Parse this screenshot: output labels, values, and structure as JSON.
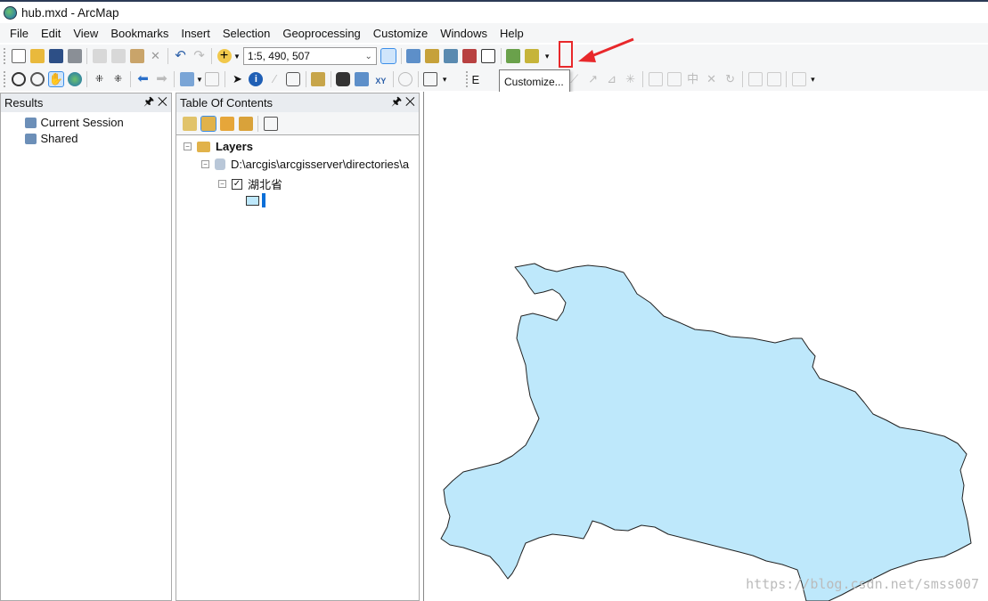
{
  "window": {
    "title": "hub.mxd - ArcMap"
  },
  "menu": [
    "File",
    "Edit",
    "View",
    "Bookmarks",
    "Insert",
    "Selection",
    "Geoprocessing",
    "Customize",
    "Windows",
    "Help"
  ],
  "toolbar": {
    "scale_value": "1:5, 490, 507",
    "tooltip": "Customize...",
    "editor_label": "E"
  },
  "results": {
    "title": "Results",
    "items": [
      "Current Session",
      "Shared"
    ]
  },
  "toc": {
    "title": "Table Of Contents",
    "layers_label": "Layers",
    "source": "D:\\arcgis\\arcgisserver\\directories\\a",
    "layer": "湖北省",
    "layer_checked": true
  },
  "map": {
    "fill_color": "#bee8fb",
    "watermark": "https://blog.csdn.net/smss007"
  },
  "colors": {
    "accent": "#3c8ee8",
    "annotation": "#e8282b"
  }
}
